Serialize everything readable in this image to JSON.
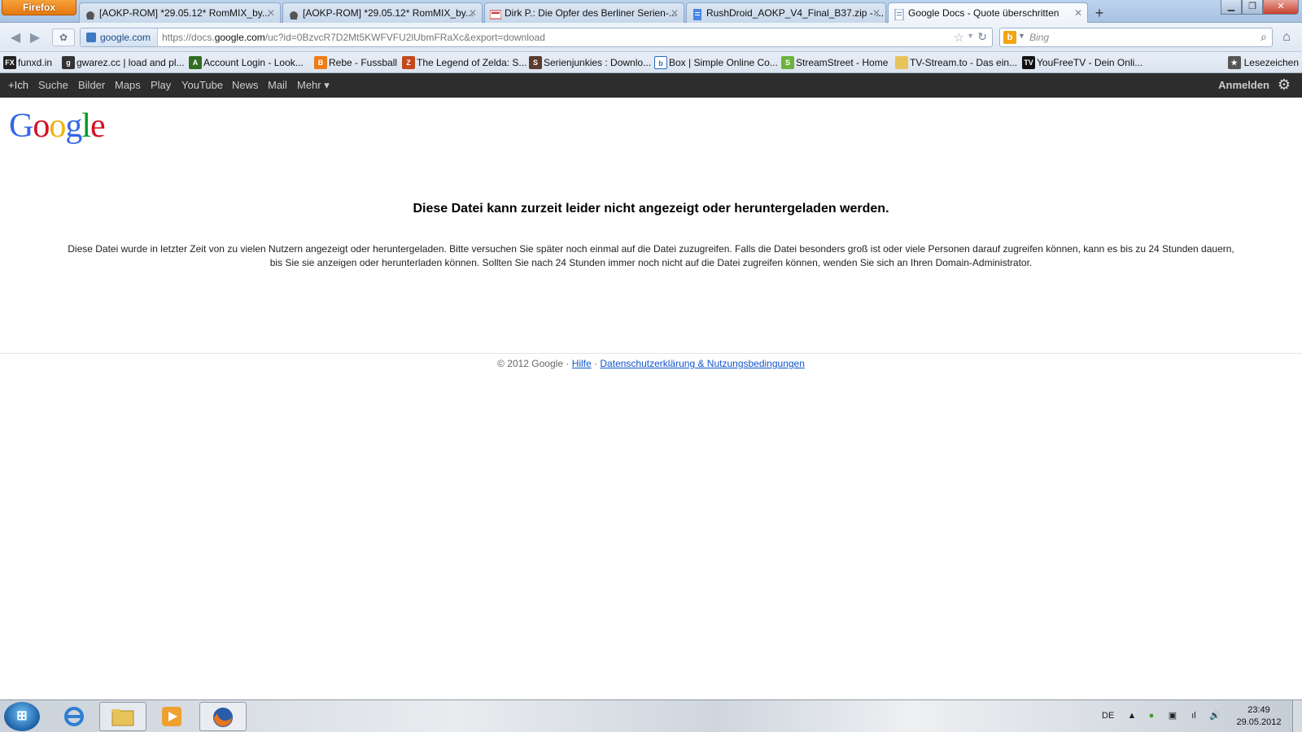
{
  "browser": {
    "menu_button": "Firefox",
    "tabs": [
      {
        "title": "[AOKP-ROM] *29.05.12* RomMIX_by...",
        "icon": "android-icon"
      },
      {
        "title": "[AOKP-ROM] *29.05.12* RomMIX_by...",
        "icon": "android-icon"
      },
      {
        "title": "Dirk P.: Die Opfer des Berliner Serien-...",
        "icon": "news-icon"
      },
      {
        "title": "RushDroid_AOKP_V4_Final_B37.zip - ...",
        "icon": "document-icon"
      },
      {
        "title": "Google Docs - Quote überschritten",
        "icon": "document-icon"
      }
    ],
    "new_tab": "+",
    "identity": "google.com",
    "url_prefix": "https://docs.",
    "url_domain": "google.com",
    "url_path": "/uc?id=0BzvcR7D2Mt5KWFVFU2lUbmFRaXc&export=download",
    "search_engine": "Bing",
    "search_placeholder": "Bing"
  },
  "bookmarks": [
    {
      "label": "funxd.in",
      "color": "#222222",
      "glyph": "FX"
    },
    {
      "label": "gwarez.cc | load and pl...",
      "color": "#333333",
      "glyph": "g"
    },
    {
      "label": "Account Login - Look...",
      "color": "#2f6d1f",
      "glyph": "A"
    },
    {
      "label": "Rebe - Fussball",
      "color": "#f07b14",
      "glyph": "B"
    },
    {
      "label": "The Legend of Zelda: S...",
      "color": "#c2491e",
      "glyph": "Z"
    },
    {
      "label": "Serienjunkies : Downlo...",
      "color": "#5a3b2e",
      "glyph": "S"
    },
    {
      "label": "Box | Simple Online Co...",
      "color": "#2b6cc4",
      "glyph": "b"
    },
    {
      "label": "StreamStreet - Home",
      "color": "#6cb33f",
      "glyph": "S"
    },
    {
      "label": "TV-Stream.to - Das ein...",
      "color": "#e8c35a",
      "glyph": ""
    },
    {
      "label": "YouFreeTV - Dein Onli...",
      "color": "#111111",
      "glyph": "TV"
    }
  ],
  "bookmarks_menu": "Lesezeichen",
  "gbar": {
    "links": [
      "+Ich",
      "Suche",
      "Bilder",
      "Maps",
      "Play",
      "YouTube",
      "News",
      "Mail",
      "Mehr ▾"
    ],
    "signin": "Anmelden"
  },
  "logo_letters": [
    "G",
    "o",
    "o",
    "g",
    "l",
    "e"
  ],
  "error": {
    "title": "Diese Datei kann zurzeit leider nicht angezeigt oder heruntergeladen werden.",
    "body": "Diese Datei wurde in letzter Zeit von zu vielen Nutzern angezeigt oder heruntergeladen. Bitte versuchen Sie später noch einmal auf die Datei zuzugreifen. Falls die Datei besonders groß ist oder viele Personen darauf zugreifen können, kann es bis zu 24 Stunden dauern, bis Sie sie anzeigen oder herunterladen können. Sollten Sie nach 24 Stunden immer noch nicht auf die Datei zugreifen können, wenden Sie sich an Ihren Domain-Administrator."
  },
  "footer": {
    "copyright": "© 2012 Google",
    "separator": "·",
    "help": "Hilfe",
    "privacy": "Datenschutzerklärung & Nutzungsbedingungen"
  },
  "taskbar": {
    "language": "DE",
    "time": "23:49",
    "date": "29.05.2012"
  }
}
